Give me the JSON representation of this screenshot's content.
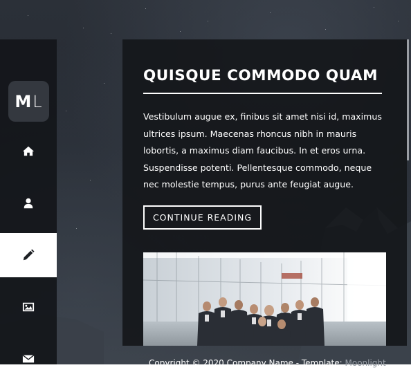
{
  "sidebar": {
    "logo": {
      "first": "M",
      "second": "L"
    },
    "nav": [
      {
        "icon": "home-icon",
        "active": false
      },
      {
        "icon": "user-icon",
        "active": false
      },
      {
        "icon": "pencil-icon",
        "active": true
      },
      {
        "icon": "image-icon",
        "active": false
      },
      {
        "icon": "envelope-icon",
        "active": false
      }
    ]
  },
  "post": {
    "title": "QUISQUE COMMODO QUAM",
    "body": "Vestibulum augue ex, finibus sit amet nisi id, maximus ultrices ipsum. Maecenas rhoncus nibh in mauris lobortis, a maximus diam faucibus. In et eros urna. Suspendisse potenti. Pellentesque commodo, neque nec molestie tempus, purus ante feugiat augue.",
    "button_label": "CONTINUE READING",
    "image_alt": "business-team-photo"
  },
  "footer": {
    "text": "Copyright © 2020 Company Name - Template: ",
    "link": "Moonlight"
  },
  "colors": {
    "panel_bg": "#16181c",
    "accent": "#ffffff",
    "active_nav_bg": "#ffffff"
  }
}
